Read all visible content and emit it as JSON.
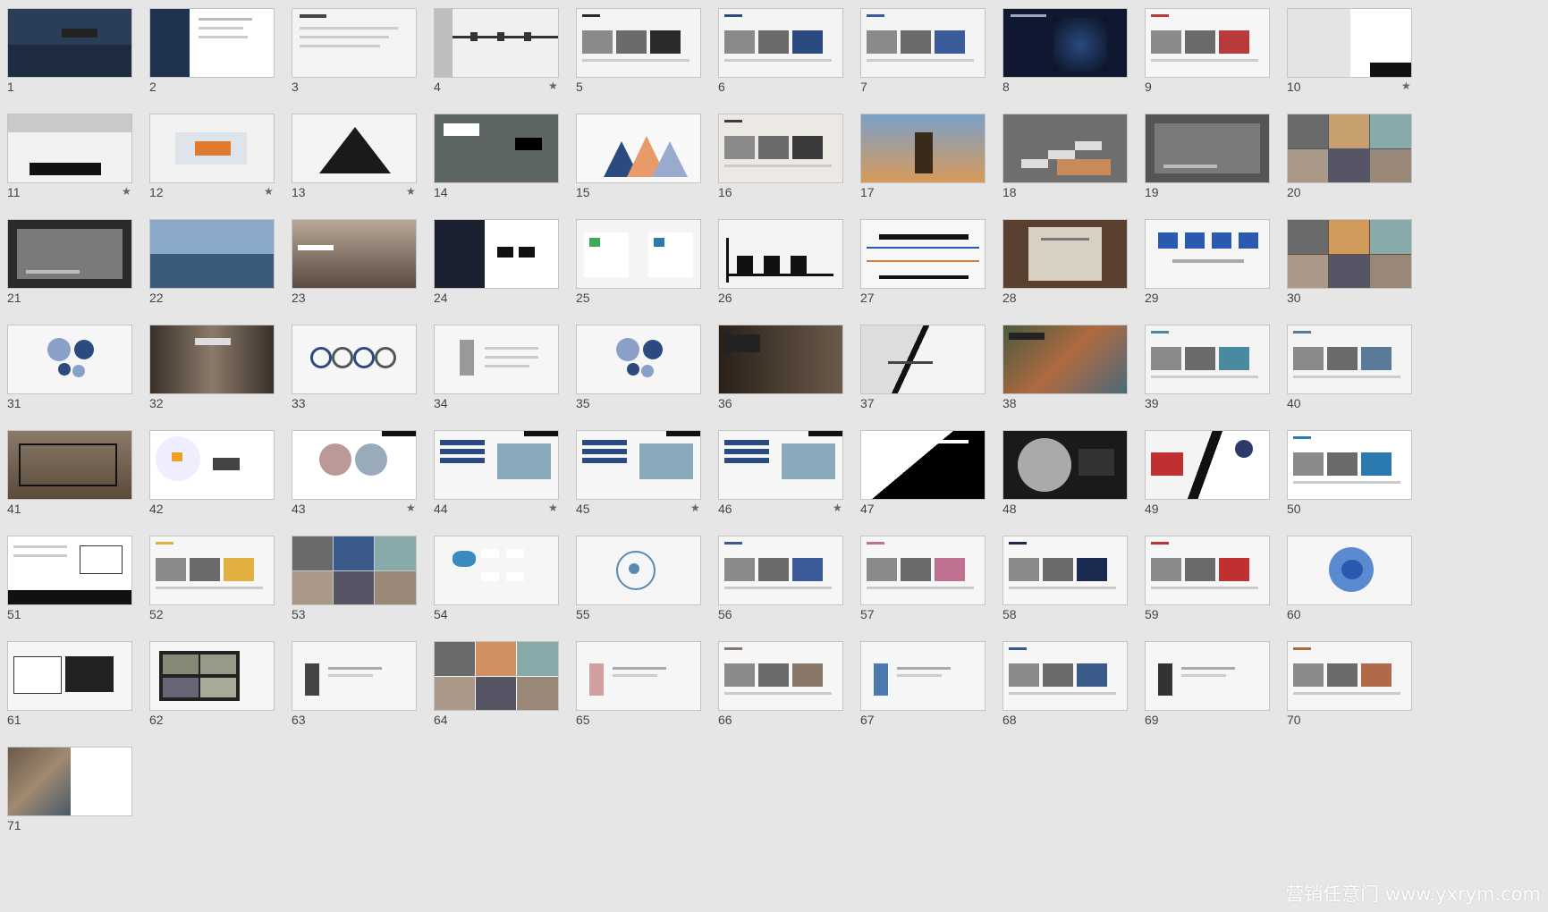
{
  "slides": [
    {
      "n": "1",
      "s": false,
      "bg": "#2b3e57",
      "a": "#6d86a6",
      "l": "plane-sky"
    },
    {
      "n": "2",
      "s": false,
      "bg": "#ffffff",
      "a": "#1f3350",
      "l": "sidebar"
    },
    {
      "n": "3",
      "s": false,
      "bg": "#f3f3f3",
      "a": "#999999",
      "l": "text"
    },
    {
      "n": "4",
      "s": true,
      "bg": "#f0f0f0",
      "a": "#333333",
      "l": "timeline"
    },
    {
      "n": "5",
      "s": false,
      "bg": "#f4f4f4",
      "a": "#2a2a2a",
      "l": "photos"
    },
    {
      "n": "6",
      "s": false,
      "bg": "#f4f4f4",
      "a": "#2b4a80",
      "l": "photos"
    },
    {
      "n": "7",
      "s": false,
      "bg": "#f4f4f4",
      "a": "#3b5b9a",
      "l": "photos"
    },
    {
      "n": "8",
      "s": false,
      "bg": "#0f1830",
      "a": "#5a7ab0",
      "l": "dark-globe"
    },
    {
      "n": "9",
      "s": false,
      "bg": "#f6f6f6",
      "a": "#b83b3b",
      "l": "photos"
    },
    {
      "n": "10",
      "s": true,
      "bg": "#ffffff",
      "a": "#222222",
      "l": "split-dark"
    },
    {
      "n": "11",
      "s": true,
      "bg": "#f2f2f2",
      "a": "#111111",
      "l": "icons-bar"
    },
    {
      "n": "12",
      "s": true,
      "bg": "#f2f2f2",
      "a": "#e07a2e",
      "l": "box-center"
    },
    {
      "n": "13",
      "s": true,
      "bg": "#f4f4f4",
      "a": "#1a1a1a",
      "l": "pyramid"
    },
    {
      "n": "14",
      "s": false,
      "bg": "#5d6660",
      "a": "#2a3a30",
      "l": "crowd"
    },
    {
      "n": "15",
      "s": false,
      "bg": "#f8f8f8",
      "a": "#e89a6a",
      "l": "mountains"
    },
    {
      "n": "16",
      "s": false,
      "bg": "#ece9e4",
      "a": "#3b3b3b",
      "l": "photos"
    },
    {
      "n": "17",
      "s": false,
      "bg": "#c9a37a",
      "a": "#4a3a2a",
      "l": "tree"
    },
    {
      "n": "18",
      "s": false,
      "bg": "#6e6e6e",
      "a": "#c88a5a",
      "l": "steps"
    },
    {
      "n": "19",
      "s": false,
      "bg": "#555555",
      "a": "#888888",
      "l": "card-dark"
    },
    {
      "n": "20",
      "s": false,
      "bg": "#4a5a70",
      "a": "#c8a070",
      "l": "collage"
    },
    {
      "n": "21",
      "s": false,
      "bg": "#2a2a2a",
      "a": "#777777",
      "l": "card-dark"
    },
    {
      "n": "22",
      "s": false,
      "bg": "#6a8aa8",
      "a": "#3a5a7a",
      "l": "sea"
    },
    {
      "n": "23",
      "s": false,
      "bg": "#7a6f66",
      "a": "#b5a595",
      "l": "mountains-photo"
    },
    {
      "n": "24",
      "s": false,
      "bg": "#ffffff",
      "a": "#111111",
      "l": "half-dark"
    },
    {
      "n": "25",
      "s": false,
      "bg": "#f4f4f4",
      "a": "#3aaa5a",
      "l": "two-box"
    },
    {
      "n": "26",
      "s": false,
      "bg": "#f4f4f4",
      "a": "#111111",
      "l": "peaks"
    },
    {
      "n": "27",
      "s": false,
      "bg": "#f7f7f7",
      "a": "#e07a2e",
      "l": "lines"
    },
    {
      "n": "28",
      "s": false,
      "bg": "#5a4030",
      "a": "#d8d0c0",
      "l": "paper-center"
    },
    {
      "n": "29",
      "s": false,
      "bg": "#f6f6f6",
      "a": "#2a5ab0",
      "l": "blue-boxes"
    },
    {
      "n": "30",
      "s": false,
      "bg": "#6a4a3a",
      "a": "#d09a5a",
      "l": "collage"
    },
    {
      "n": "31",
      "s": false,
      "bg": "#f6f6f6",
      "a": "#2b4a80",
      "l": "circles"
    },
    {
      "n": "32",
      "s": false,
      "bg": "#504840",
      "a": "#a09080",
      "l": "hands"
    },
    {
      "n": "33",
      "s": false,
      "bg": "#f6f6f6",
      "a": "#2b4a80",
      "l": "rings"
    },
    {
      "n": "34",
      "s": false,
      "bg": "#f6f6f6",
      "a": "#555555",
      "l": "phone"
    },
    {
      "n": "35",
      "s": false,
      "bg": "#f6f6f6",
      "a": "#2b4a80",
      "l": "circles"
    },
    {
      "n": "36",
      "s": false,
      "bg": "#4a3a30",
      "a": "#c0a080",
      "l": "people-photo"
    },
    {
      "n": "37",
      "s": false,
      "bg": "#f4f4f4",
      "a": "#111111",
      "l": "diagonal"
    },
    {
      "n": "38",
      "s": false,
      "bg": "#5a6a50",
      "a": "#c05a3a",
      "l": "map-photo"
    },
    {
      "n": "39",
      "s": false,
      "bg": "#f4f4f4",
      "a": "#4a8aa0",
      "l": "photos"
    },
    {
      "n": "40",
      "s": false,
      "bg": "#f4f4f4",
      "a": "#5a7a9a",
      "l": "photos"
    },
    {
      "n": "41",
      "s": false,
      "bg": "#6a5a4a",
      "a": "#111111",
      "l": "box-photo"
    },
    {
      "n": "42",
      "s": false,
      "bg": "#ffffff",
      "a": "#f0a020",
      "l": "fishbowl"
    },
    {
      "n": "43",
      "s": true,
      "bg": "#ffffff",
      "a": "#555555",
      "l": "circle-photo"
    },
    {
      "n": "44",
      "s": true,
      "bg": "#f6f6f6",
      "a": "#2b4a80",
      "l": "list-photo"
    },
    {
      "n": "45",
      "s": true,
      "bg": "#f6f6f6",
      "a": "#2b4a80",
      "l": "list-photo"
    },
    {
      "n": "46",
      "s": true,
      "bg": "#f6f6f6",
      "a": "#2b4a80",
      "l": "list-photo"
    },
    {
      "n": "47",
      "s": false,
      "bg": "#ffffff",
      "a": "#000000",
      "l": "diag-dark"
    },
    {
      "n": "48",
      "s": false,
      "bg": "#1a1a1a",
      "a": "#cccccc",
      "l": "wordcloud"
    },
    {
      "n": "49",
      "s": false,
      "bg": "#f4f4f4",
      "a": "#c03030",
      "l": "slash"
    },
    {
      "n": "50",
      "s": false,
      "bg": "#ffffff",
      "a": "#2a7ab0",
      "l": "photos"
    },
    {
      "n": "51",
      "s": false,
      "bg": "#ffffff",
      "a": "#111111",
      "l": "text-footer"
    },
    {
      "n": "52",
      "s": false,
      "bg": "#f6f6f6",
      "a": "#e0b040",
      "l": "photos"
    },
    {
      "n": "53",
      "s": false,
      "bg": "#c0c8d0",
      "a": "#3a5a8a",
      "l": "collage"
    },
    {
      "n": "54",
      "s": false,
      "bg": "#f6f6f6",
      "a": "#3a8ac0",
      "l": "stats"
    },
    {
      "n": "55",
      "s": false,
      "bg": "#f6f6f6",
      "a": "#5a8ab0",
      "l": "radial"
    },
    {
      "n": "56",
      "s": false,
      "bg": "#f6f6f6",
      "a": "#3a5a9a",
      "l": "photos"
    },
    {
      "n": "57",
      "s": false,
      "bg": "#f6f6f6",
      "a": "#c07090",
      "l": "photos"
    },
    {
      "n": "58",
      "s": false,
      "bg": "#f6f6f6",
      "a": "#1a2a50",
      "l": "photos"
    },
    {
      "n": "59",
      "s": false,
      "bg": "#f6f6f6",
      "a": "#c03030",
      "l": "photos"
    },
    {
      "n": "60",
      "s": false,
      "bg": "#f6f6f6",
      "a": "#5a8ad0",
      "l": "circle-blue"
    },
    {
      "n": "61",
      "s": false,
      "bg": "#f6f6f6",
      "a": "#222222",
      "l": "rings-dark"
    },
    {
      "n": "62",
      "s": false,
      "bg": "#f6f6f6",
      "a": "#222222",
      "l": "photo-grid"
    },
    {
      "n": "63",
      "s": false,
      "bg": "#f6f6f6",
      "a": "#444444",
      "l": "person"
    },
    {
      "n": "64",
      "s": false,
      "bg": "#f6f6f6",
      "a": "#d09060",
      "l": "collage"
    },
    {
      "n": "65",
      "s": false,
      "bg": "#f6f6f6",
      "a": "#d0a0a0",
      "l": "person"
    },
    {
      "n": "66",
      "s": false,
      "bg": "#f6f6f6",
      "a": "#887766",
      "l": "photos"
    },
    {
      "n": "67",
      "s": false,
      "bg": "#f6f6f6",
      "a": "#4a7ab0",
      "l": "person"
    },
    {
      "n": "68",
      "s": false,
      "bg": "#f6f6f6",
      "a": "#3a5a8a",
      "l": "photos"
    },
    {
      "n": "69",
      "s": false,
      "bg": "#f6f6f6",
      "a": "#333333",
      "l": "person"
    },
    {
      "n": "70",
      "s": false,
      "bg": "#f6f6f6",
      "a": "#b06a4a",
      "l": "photos"
    },
    {
      "n": "71",
      "s": false,
      "bg": "#ffffff",
      "a": "#7a6a5a",
      "l": "half-photo"
    }
  ],
  "watermark": "营销任意门 www.yxrym.com"
}
